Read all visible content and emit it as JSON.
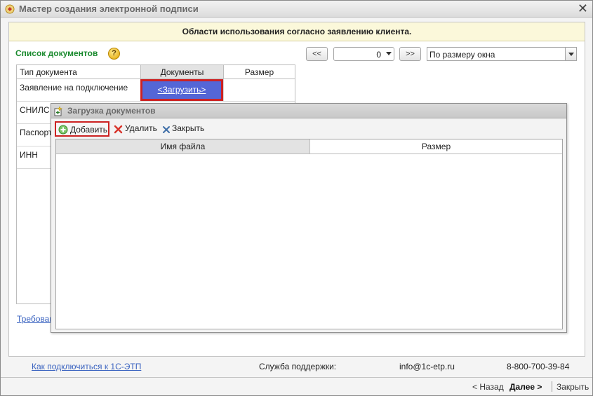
{
  "window": {
    "title": "Мастер создания электронной подписи",
    "close_glyph": "✕"
  },
  "banner": {
    "text": "Области использования согласно заявлению клиента."
  },
  "documents": {
    "section_label": "Список документов",
    "help_glyph": "?",
    "pager": {
      "prev_label": "<<",
      "next_label": ">>",
      "page_value": "0"
    },
    "zoom": {
      "selected": "По размеру окна"
    },
    "columns": [
      "Тип документа",
      "Документы",
      "Размер"
    ],
    "rows": [
      {
        "type": "Заявление на подключение",
        "action": "<Загрузить>"
      },
      {
        "type": "СНИЛС"
      },
      {
        "type": "Паспорт"
      },
      {
        "type": "ИНН"
      }
    ],
    "requirements_link": "Требован"
  },
  "dialog": {
    "title": "Загрузка документов",
    "toolbar": {
      "add_label": "Добавить",
      "delete_label": "Удалить",
      "close_label": "Закрыть"
    },
    "columns": [
      "Имя файла",
      "Размер"
    ]
  },
  "footer": {
    "connect_link": "Как подключиться к 1С-ЭТП",
    "support_label": "Служба поддержки:",
    "email": "info@1c-etp.ru",
    "phone": "8-800-700-39-84"
  },
  "nav": {
    "back_label": "< Назад",
    "next_label": "Далее  >",
    "close_label": "Закрыть"
  },
  "colors": {
    "accent_green": "#1a8a2e",
    "highlight_red": "#cc2222",
    "selected_cell": "#5466d6",
    "link_blue": "#3a63c0",
    "banner_bg": "#fbf8da"
  }
}
